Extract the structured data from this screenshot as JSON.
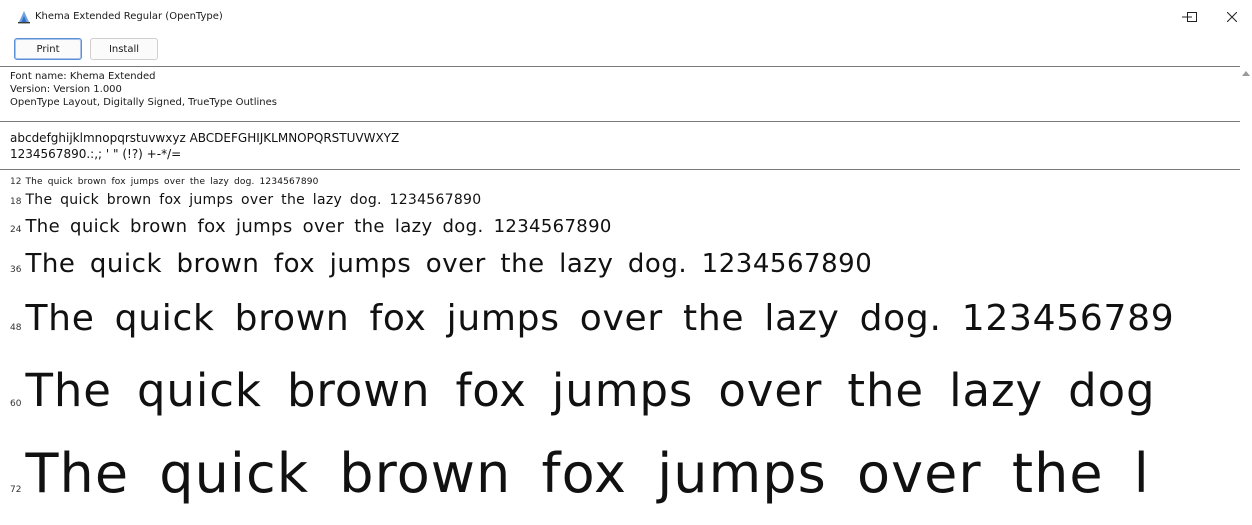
{
  "window": {
    "title": "Khema Extended Regular (OpenType)"
  },
  "toolbar": {
    "print_label": "Print",
    "install_label": "Install"
  },
  "info": {
    "font_name": "Font name: Khema Extended",
    "version": "Version: Version 1.000",
    "features": "OpenType Layout, Digitally Signed, TrueType Outlines"
  },
  "charset": {
    "line1": "abcdefghijklmnopqrstuvwxyz  ABCDEFGHIJKLMNOPQRSTUVWXYZ",
    "line2": "1234567890.:,;  '  \"  (!?)  +-*/="
  },
  "samples": [
    {
      "size": "12",
      "text": "The quick brown fox jumps over the lazy dog. 1234567890"
    },
    {
      "size": "18",
      "text": "The quick brown fox jumps over the lazy dog. 1234567890"
    },
    {
      "size": "24",
      "text": "The quick brown fox jumps over the lazy dog. 1234567890"
    },
    {
      "size": "36",
      "text": "The quick brown fox jumps over the lazy dog. 1234567890"
    },
    {
      "size": "48",
      "text": "The quick brown fox jumps over the lazy dog. 123456789"
    },
    {
      "size": "60",
      "text": "The quick brown fox jumps over the lazy dog"
    },
    {
      "size": "72",
      "text": "The quick brown fox jumps over the l"
    }
  ],
  "icons": {
    "app": "font-viewer-icon",
    "minimize": "minimize-icon",
    "maximize": "maximize-icon",
    "close": "close-icon",
    "scroll_up": "scroll-up-arrow-icon"
  }
}
